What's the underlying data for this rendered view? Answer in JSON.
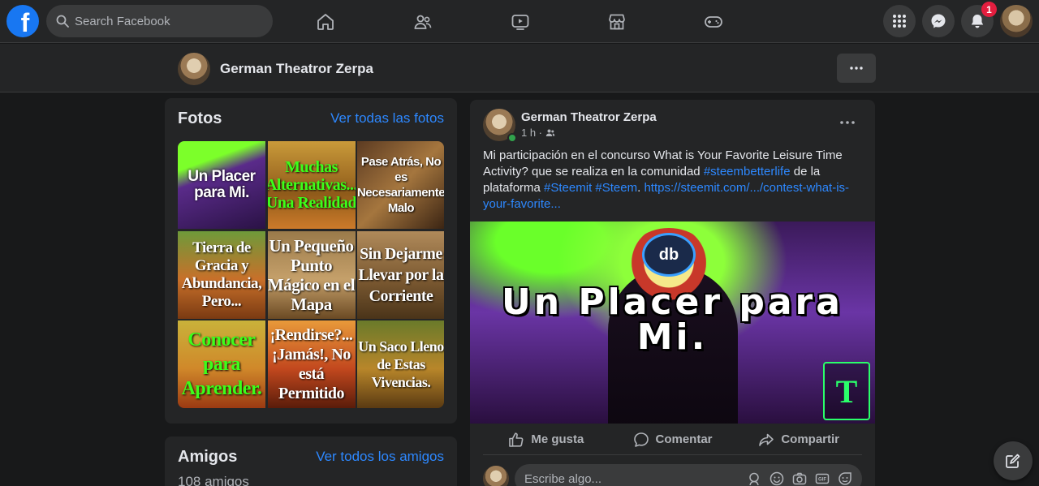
{
  "topnav": {
    "logo_letter": "f",
    "search_placeholder": "Search Facebook",
    "notification_count": "1"
  },
  "profile": {
    "name": "German Theatror Zerpa"
  },
  "photos": {
    "title": "Fotos",
    "see_all": "Ver todas las fotos",
    "items": [
      "Un Placer para Mi.",
      "Muchas Alternativas... Una Realidad",
      "Pase Atrás, No es Necesariamente Malo",
      "Tierra de Gracia y Abundancia, Pero...",
      "Un Pequeño Punto Mágico en el Mapa",
      "Sin Dejarme Llevar por la Corriente",
      "Conocer para Aprender.",
      "¡Rendirse?... ¡Jamás!, No está Permitido",
      "Un Saco Lleno de Estas Vivencias."
    ]
  },
  "friends": {
    "title": "Amigos",
    "see_all": "Ver todos los amigos",
    "count": "108 amigos"
  },
  "post": {
    "author": "German Theatror Zerpa",
    "time": "1 h ·",
    "text_1": "Mi participación en el concurso What is Your Favorite Leisure Time Activity? que se realiza en la comunidad ",
    "tag_1": "#steembetterlife",
    "text_2": " de la plataforma ",
    "tag_2": "#Steemit",
    "tag_3": "#Steem",
    "text_3": ". ",
    "url": "https://steemit.com/.../contest-what-is-your-favorite...",
    "image_text": "Un Placer para Mi.",
    "image_logo": "db",
    "image_sig": "T",
    "actions": {
      "like": "Me gusta",
      "comment": "Comentar",
      "share": "Compartir"
    },
    "comment_placeholder": "Escribe algo..."
  },
  "colors": {
    "brand": "#1877f2",
    "link": "#2d88ff",
    "badge": "#e41e3f",
    "online": "#31a24c"
  }
}
